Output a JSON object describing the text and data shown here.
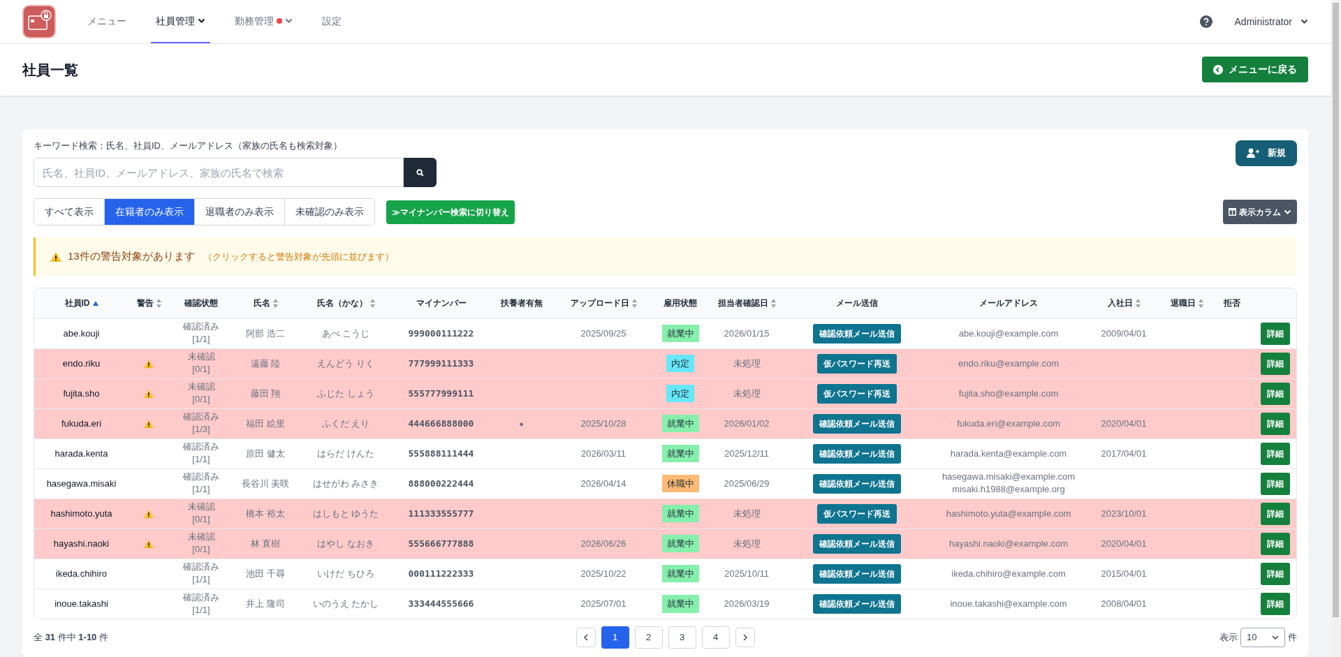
{
  "nav": {
    "items": [
      {
        "label": "メニュー",
        "selected": false,
        "dropdown": false,
        "alert_dot": false
      },
      {
        "label": "社員管理",
        "selected": true,
        "dropdown": true,
        "alert_dot": false
      },
      {
        "label": "勤務管理",
        "selected": false,
        "dropdown": true,
        "alert_dot": true
      },
      {
        "label": "設定",
        "selected": false,
        "dropdown": false,
        "alert_dot": false
      }
    ],
    "user": "Administrator"
  },
  "page": {
    "title": "社員一覧",
    "back_button": "メニューに戻る"
  },
  "search": {
    "label": "キーワード検索：氏名、社員ID、メールアドレス（家族の氏名も検索対象）",
    "placeholder": "氏名、社員ID、メールアドレス、家族の氏名で検索",
    "new_button": "新規"
  },
  "filters": [
    {
      "label": "すべて表示",
      "selected": false
    },
    {
      "label": "在籍者のみ表示",
      "selected": true
    },
    {
      "label": "退職者のみ表示",
      "selected": false
    },
    {
      "label": "未確認のみ表示",
      "selected": false
    }
  ],
  "mynumber_toggle": "≫マイナンバー検索に切り替え",
  "columns_button": "表示カラム",
  "alert": {
    "message": "13件の警告対象があります",
    "hint": "（クリックすると警告対象が先頭に並びます）"
  },
  "table": {
    "columns": [
      {
        "label": "社員ID",
        "sortable": true,
        "sorted_ascending": true
      },
      {
        "label": "警告",
        "sortable": true,
        "sorted_ascending": false
      },
      {
        "label": "確認状態",
        "sortable": false,
        "sorted_ascending": false
      },
      {
        "label": "氏名",
        "sortable": true,
        "sorted_ascending": false
      },
      {
        "label": "氏名（かな）",
        "sortable": true,
        "sorted_ascending": false
      },
      {
        "label": "マイナンバー",
        "sortable": false,
        "sorted_ascending": false
      },
      {
        "label": "扶養者有無",
        "sortable": false,
        "sorted_ascending": false
      },
      {
        "label": "アップロード日",
        "sortable": true,
        "sorted_ascending": false
      },
      {
        "label": "雇用状態",
        "sortable": false,
        "sorted_ascending": false
      },
      {
        "label": "担当者確認日",
        "sortable": true,
        "sorted_ascending": false
      },
      {
        "label": "メール送信",
        "sortable": false,
        "sorted_ascending": false
      },
      {
        "label": "メールアドレス",
        "sortable": false,
        "sorted_ascending": false
      },
      {
        "label": "入社日",
        "sortable": true,
        "sorted_ascending": false
      },
      {
        "label": "退職日",
        "sortable": true,
        "sorted_ascending": false
      },
      {
        "label": "拒否",
        "sortable": false,
        "sorted_ascending": false
      }
    ],
    "rows": [
      {
        "id": "abe.kouji",
        "warning": false,
        "confirm": "確認済み\n[1/1]",
        "name": "阿部 浩二",
        "kana": "あべ こうじ",
        "mynumber": "999000111222",
        "upload": "2025/09/25",
        "employment": {
          "label": "就業中",
          "color": "#86efac"
        },
        "checked_date": "2026/01/15",
        "mail_button": "確認依頼メール送信",
        "email": "abe.kouji@example.com",
        "joined": "2009/04/01",
        "action": "詳細"
      },
      {
        "id": "endo.riku",
        "warning": true,
        "confirm": "未確認\n[0/1]",
        "name": "遠藤 陸",
        "kana": "えんどう りく",
        "mynumber": "777999111333",
        "employment": {
          "label": "内定",
          "color": "#67e8f9"
        },
        "checked_date": "未処理",
        "mail_button": "仮パスワード再送",
        "email": "endo.riku@example.com",
        "action": "詳細"
      },
      {
        "id": "fujita.sho",
        "warning": true,
        "confirm": "未確認\n[0/1]",
        "name": "藤田 翔",
        "kana": "ふじた しょう",
        "mynumber": "555777999111",
        "employment": {
          "label": "内定",
          "color": "#67e8f9"
        },
        "checked_date": "未処理",
        "mail_button": "仮パスワード再送",
        "email": "fujita.sho@example.com",
        "action": "詳細"
      },
      {
        "id": "fukuda.eri",
        "warning": true,
        "confirm": "確認済み\n[1/3]",
        "name": "福田 絵里",
        "kana": "ふくだ えり",
        "mynumber": "444666888000",
        "dependents": "●",
        "upload": "2025/10/28",
        "employment": {
          "label": "就業中",
          "color": "#86efac"
        },
        "checked_date": "2026/01/02",
        "mail_button": "確認依頼メール送信",
        "email": "fukuda.eri@example.com",
        "joined": "2020/04/01",
        "action": "詳細"
      },
      {
        "id": "harada.kenta",
        "warning": false,
        "confirm": "確認済み\n[1/1]",
        "name": "原田 健太",
        "kana": "はらだ けんた",
        "mynumber": "555888111444",
        "upload": "2026/03/11",
        "employment": {
          "label": "就業中",
          "color": "#86efac"
        },
        "checked_date": "2025/12/11",
        "mail_button": "確認依頼メール送信",
        "email": "harada.kenta@example.com",
        "joined": "2017/04/01",
        "action": "詳細"
      },
      {
        "id": "hasegawa.misaki",
        "warning": false,
        "confirm": "確認済み\n[1/1]",
        "name": "長谷川 美咲",
        "kana": "はせがわ みさき",
        "mynumber": "888000222444",
        "upload": "2026/04/14",
        "employment": {
          "label": "休職中",
          "color": "#fdba74"
        },
        "checked_date": "2025/06/29",
        "mail_button": "確認依頼メール送信",
        "email": "hasegawa.misaki@example.com\nmisaki.h1988@example.org",
        "action": "詳細"
      },
      {
        "id": "hashimoto.yuta",
        "warning": true,
        "confirm": "未確認\n[0/1]",
        "name": "橋本 裕太",
        "kana": "はしもと ゆうた",
        "mynumber": "111333555777",
        "employment": {
          "label": "就業中",
          "color": "#86efac"
        },
        "checked_date": "未処理",
        "mail_button": "仮パスワード再送",
        "email": "hashimoto.yuta@example.com",
        "joined": "2023/10/01",
        "action": "詳細"
      },
      {
        "id": "hayashi.naoki",
        "warning": true,
        "confirm": "未確認\n[0/1]",
        "name": "林 直樹",
        "kana": "はやし なおき",
        "mynumber": "555666777888",
        "upload": "2026/06/26",
        "employment": {
          "label": "就業中",
          "color": "#86efac"
        },
        "checked_date": "未処理",
        "mail_button": "確認依頼メール送信",
        "email": "hayashi.naoki@example.com",
        "joined": "2020/04/01",
        "action": "詳細"
      },
      {
        "id": "ikeda.chihiro",
        "warning": false,
        "confirm": "確認済み\n[1/1]",
        "name": "池田 千尋",
        "kana": "いけだ ちひろ",
        "mynumber": "000111222333",
        "upload": "2025/10/22",
        "employment": {
          "label": "就業中",
          "color": "#86efac"
        },
        "checked_date": "2025/10/11",
        "mail_button": "確認依頼メール送信",
        "email": "ikeda.chihiro@example.com",
        "joined": "2015/04/01",
        "action": "詳細"
      },
      {
        "id": "inoue.takashi",
        "warning": false,
        "confirm": "確認済み\n[1/1]",
        "name": "井上 隆司",
        "kana": "いのうえ たかし",
        "mynumber": "333444555666",
        "upload": "2025/07/01",
        "employment": {
          "label": "就業中",
          "color": "#86efac"
        },
        "checked_date": "2026/03/19",
        "mail_button": "確認依頼メール送信",
        "email": "inoue.takashi@example.com",
        "joined": "2008/04/01",
        "action": "詳細"
      }
    ]
  },
  "footer": {
    "summary": "全 **31** 件中 **1-10** 件",
    "pages": [
      {
        "label": "1",
        "selected": true
      },
      {
        "label": "2",
        "selected": false
      },
      {
        "label": "3",
        "selected": false
      },
      {
        "label": "4",
        "selected": false
      }
    ],
    "page_size_label": "表示",
    "page_size": "10",
    "page_size_unit": "件"
  }
}
